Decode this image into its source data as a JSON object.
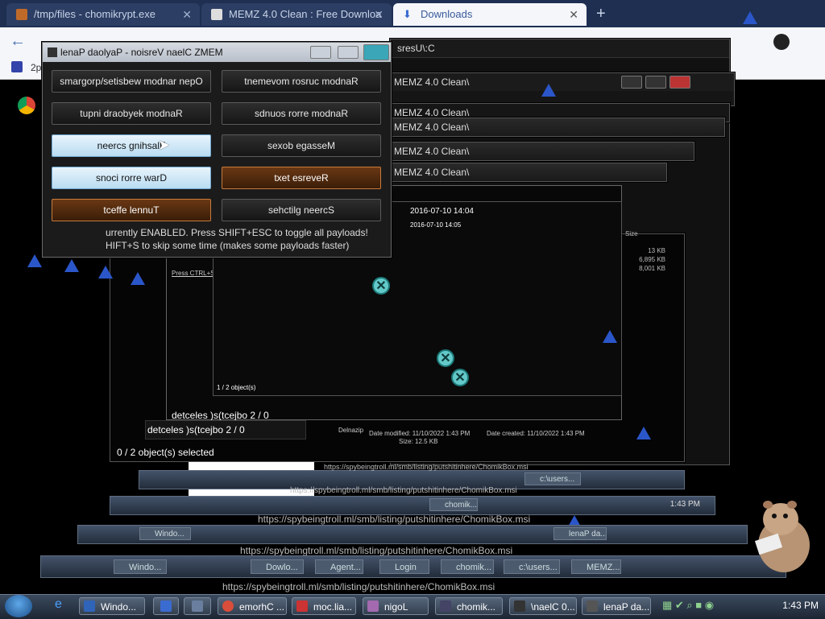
{
  "browser": {
    "tabs": [
      {
        "label": "/tmp/files - chomikrypt.exe",
        "active": false
      },
      {
        "label": "MEMZ 4.0 Clean : Free Downloa",
        "active": false
      },
      {
        "label": "Downloads",
        "active": true
      }
    ],
    "new_tab": "+",
    "bookmark": "2p"
  },
  "memz": {
    "title": "lenaP daolyaP - noisreV naelC ZMEM",
    "buttons": [
      {
        "label": "smargorp/setisbew modnar nepO",
        "state": "off"
      },
      {
        "label": "tnemevom rosruc modnaR",
        "state": "off"
      },
      {
        "label": "tupni draobyek modnaR",
        "state": "off"
      },
      {
        "label": "sdnuos rorre modnaR",
        "state": "off"
      },
      {
        "label": "neercs gnihsalF",
        "state": "on"
      },
      {
        "label": "sexob egasseM",
        "state": "off"
      },
      {
        "label": "snoci rorre warD",
        "state": "on"
      },
      {
        "label": "txet esreveR",
        "state": "orange"
      },
      {
        "label": "tceffe lennuT",
        "state": "orange"
      },
      {
        "label": "sehctilg neercS",
        "state": "off"
      }
    ],
    "status_line1": "urrently ENABLED. Press SHIFT+ESC to toggle all payloads!",
    "status_line2": "HIFT+S to skip some time (makes some payloads faster)"
  },
  "explorer": {
    "path_top": "sresU\\:C",
    "path1": "MEMZ 4.0 Clean\\",
    "path2": "MEMZ 4.0 Clean\\",
    "path3": "MEMZ 4.0 Clean\\",
    "path4": "MEMZ 4.0 Clean\\",
    "path5": "MEMZ 4.0 Clean\\",
    "row_date1": "2016-07-10 14:04",
    "row_date2": "2016-07-10 14:05",
    "size_header": "Size",
    "sizes": [
      "13 KB",
      "6,895 KB",
      "8,001 KB"
    ],
    "press_line": "Press CTRL+SHIFT+S to dismiss",
    "selected_small": "1 / 2 object(s)",
    "selected_rev1": "detceles )s(tcejbo 2 / 0",
    "selected_rev2": "detceles )s(tcejbo 2 / 0",
    "selected_main": "0 / 2 object(s) selected",
    "details_name": "Delnazip",
    "details_modified": "Date modified: 11/10/2022 1:43 PM",
    "details_created": "Date created: 11/10/2022 1:43 PM",
    "details_size": "Size: 12.5 KB"
  },
  "urls": [
    "https://spybeingtroll.ml/smb/listing/putshitinhere/ChomikBox.msi",
    "https://spybeingtroll.ml/smb/listing/putshitinhere/ChomikBox.msi",
    "https://spybeingtroll.ml/smb/listing/putshitinhere/ChomikBox.msi",
    "https://spybeingtroll.ml/smb/listing/putshitinhere/ChomikBox.msi",
    "https://spybeingtroll.ml/smb/listing/putshitinhere/ChomikBox.msi"
  ],
  "taskbar": {
    "items": [
      {
        "label": "Windo...",
        "icon_color": "#2f64b8"
      },
      {
        "label": "",
        "icon_color": "#3a6bd0"
      },
      {
        "label": "",
        "icon_color": "#6a7fa0"
      },
      {
        "label": "emorhC ...",
        "icon_color": "#d94d3a"
      },
      {
        "label": "moc.lia...",
        "icon_color": "#c33"
      },
      {
        "label": "nigoL",
        "icon_color": "#a36ab0"
      },
      {
        "label": "chomik...",
        "icon_color": "#446"
      },
      {
        "label": "\\naelC 0...",
        "icon_color": "#333"
      },
      {
        "label": "lenaP da...",
        "icon_color": "#555"
      }
    ],
    "echo_items": [
      "Windo...",
      "Agent...",
      "Dowlo...",
      "Login",
      "chomik...",
      "c:\\users...",
      "MEMZ...",
      "lenaP da..."
    ],
    "time": "1:43 PM",
    "echo_time": "1:43 PM"
  },
  "colors": {
    "panel_on": "#b9dcf2",
    "panel_orange": "#6a3814",
    "taskbar": "#2a3546",
    "warning_blue": "#2b56c9",
    "x_icon": "#63c9c9"
  }
}
